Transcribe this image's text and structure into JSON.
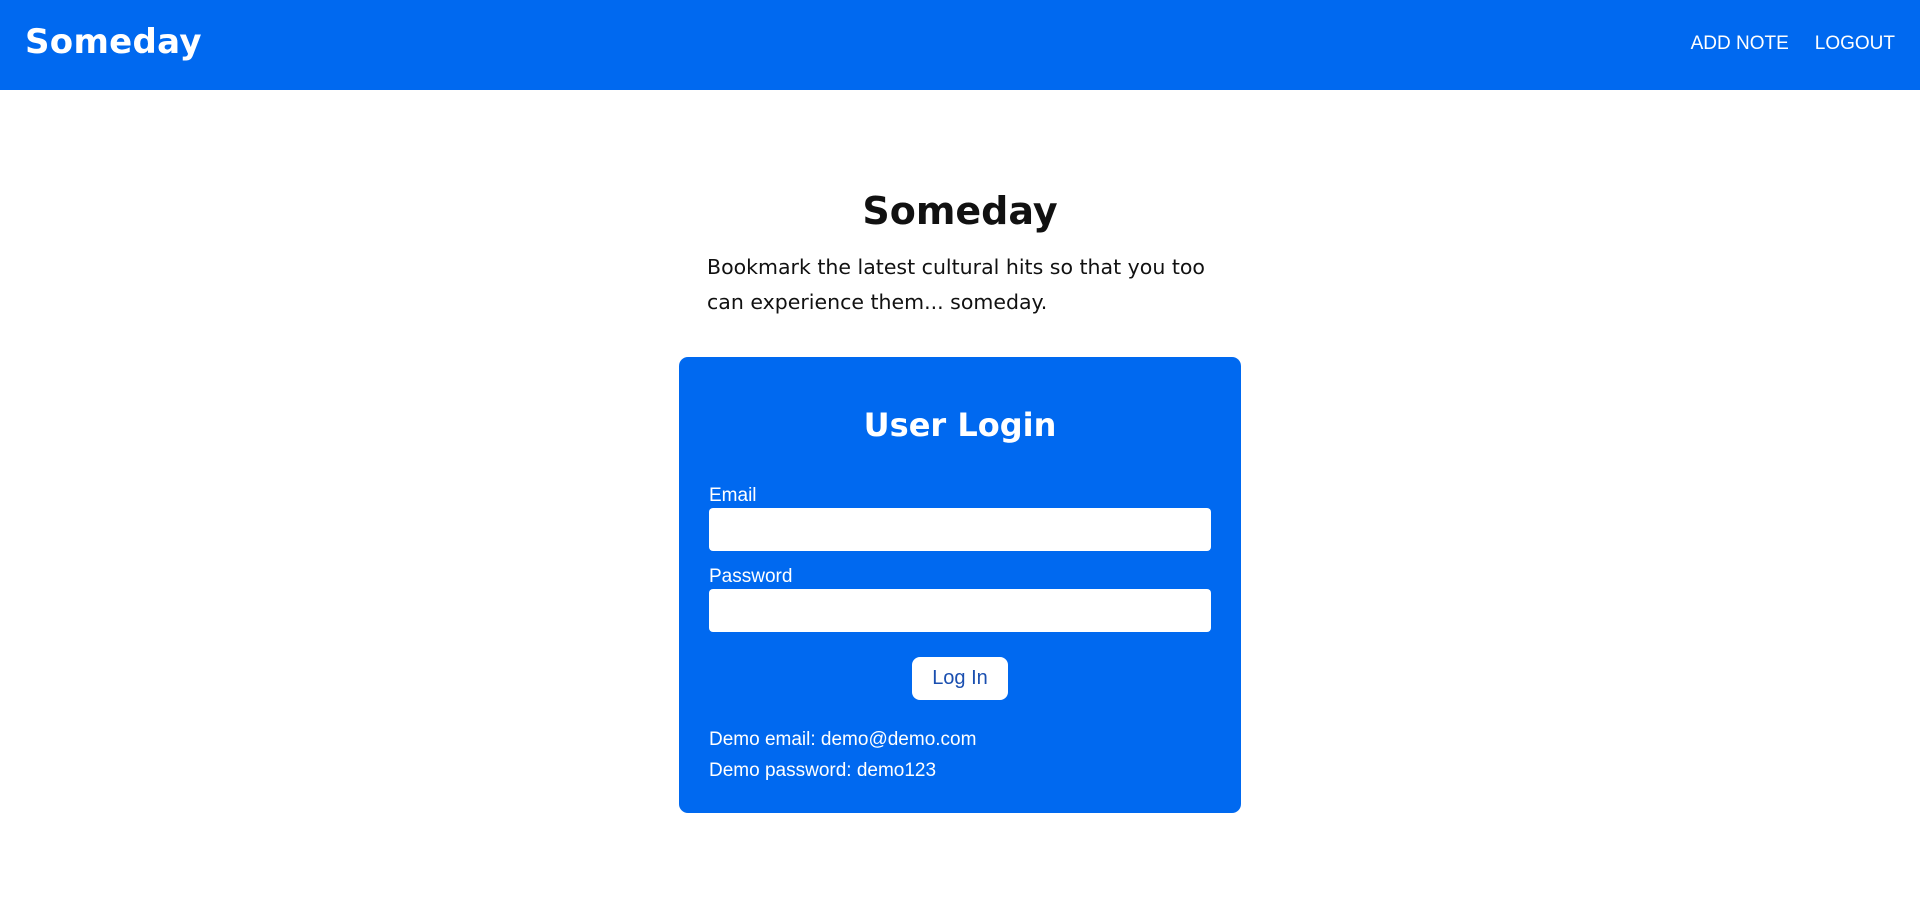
{
  "navbar": {
    "brand": "Someday",
    "links": [
      {
        "label": "ADD NOTE"
      },
      {
        "label": "LOGOUT"
      }
    ]
  },
  "hero": {
    "title": "Someday",
    "description": "Bookmark the latest cultural hits so that you too can experience them... someday."
  },
  "login": {
    "title": "User Login",
    "email_label": "Email",
    "email_value": "",
    "password_label": "Password",
    "password_value": "",
    "button_label": "Log In",
    "demo_email": "Demo email: demo@demo.com",
    "demo_password": "Demo password: demo123"
  },
  "colors": {
    "primary": "#0069f0",
    "button_text": "#1a4fb0",
    "background": "#ffffff"
  }
}
